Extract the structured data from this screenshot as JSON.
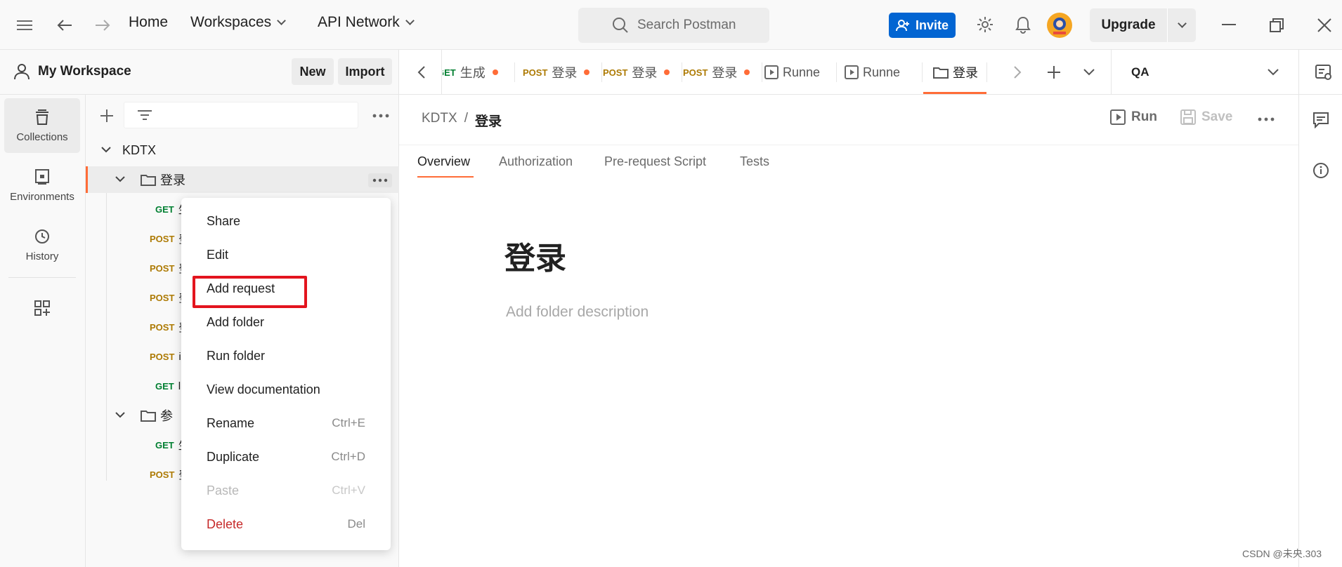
{
  "topbar": {
    "home": "Home",
    "workspaces": "Workspaces",
    "api_network": "API Network",
    "search_placeholder": "Search Postman",
    "invite": "Invite",
    "upgrade": "Upgrade"
  },
  "workspace": {
    "title": "My Workspace",
    "new_label": "New",
    "import_label": "Import"
  },
  "rail": [
    {
      "label": "Collections",
      "icon": "collections-icon"
    },
    {
      "label": "Environments",
      "icon": "environments-icon"
    },
    {
      "label": "History",
      "icon": "history-icon"
    }
  ],
  "tree": {
    "collection": "KDTX",
    "folder1": "登录",
    "folder2_visible": "参",
    "requests": [
      {
        "method": "GET",
        "name": "生"
      },
      {
        "method": "POST",
        "name": "登"
      },
      {
        "method": "POST",
        "name": "登"
      },
      {
        "method": "POST",
        "name": "登"
      },
      {
        "method": "POST",
        "name": "登"
      },
      {
        "method": "POST",
        "name": "i"
      },
      {
        "method": "GET",
        "name": "l"
      }
    ],
    "folder2_requests": [
      {
        "method": "GET",
        "name": "生"
      },
      {
        "method": "POST",
        "name": "登"
      }
    ]
  },
  "context_menu": {
    "items": [
      {
        "label": "Share",
        "shortcut": ""
      },
      {
        "label": "Edit",
        "shortcut": ""
      },
      {
        "label": "Add request",
        "shortcut": ""
      },
      {
        "label": "Add folder",
        "shortcut": ""
      },
      {
        "label": "Run folder",
        "shortcut": ""
      },
      {
        "label": "View documentation",
        "shortcut": ""
      },
      {
        "label": "Rename",
        "shortcut": "Ctrl+E"
      },
      {
        "label": "Duplicate",
        "shortcut": "Ctrl+D"
      },
      {
        "label": "Paste",
        "shortcut": "Ctrl+V"
      },
      {
        "label": "Delete",
        "shortcut": "Del"
      }
    ]
  },
  "tabs": [
    {
      "method": "GET",
      "name": "生成",
      "unsaved": true
    },
    {
      "method": "POST",
      "name": "登录",
      "unsaved": true
    },
    {
      "method": "POST",
      "name": "登录",
      "unsaved": true
    },
    {
      "method": "POST",
      "name": "登录",
      "unsaved": true
    },
    {
      "method": "",
      "name": "Runne",
      "unsaved": false
    },
    {
      "method": "",
      "name": "Runne",
      "unsaved": false
    },
    {
      "method": "",
      "name": "登录",
      "unsaved": false
    }
  ],
  "environment": "QA",
  "main": {
    "breadcrumb_parent": "KDTX",
    "breadcrumb_sep": "/",
    "breadcrumb_current": "登录",
    "run_label": "Run",
    "save_label": "Save",
    "subtabs": [
      "Overview",
      "Authorization",
      "Pre-request Script",
      "Tests"
    ],
    "folder_title": "登录",
    "description_placeholder": "Add folder description"
  },
  "watermark": "CSDN @未央.303",
  "colors": {
    "accent": "#ff6c37",
    "invite_blue": "#0265d2",
    "get_green": "#007f31",
    "post_orange": "#ad7a03",
    "highlight_red": "#e3141e"
  }
}
